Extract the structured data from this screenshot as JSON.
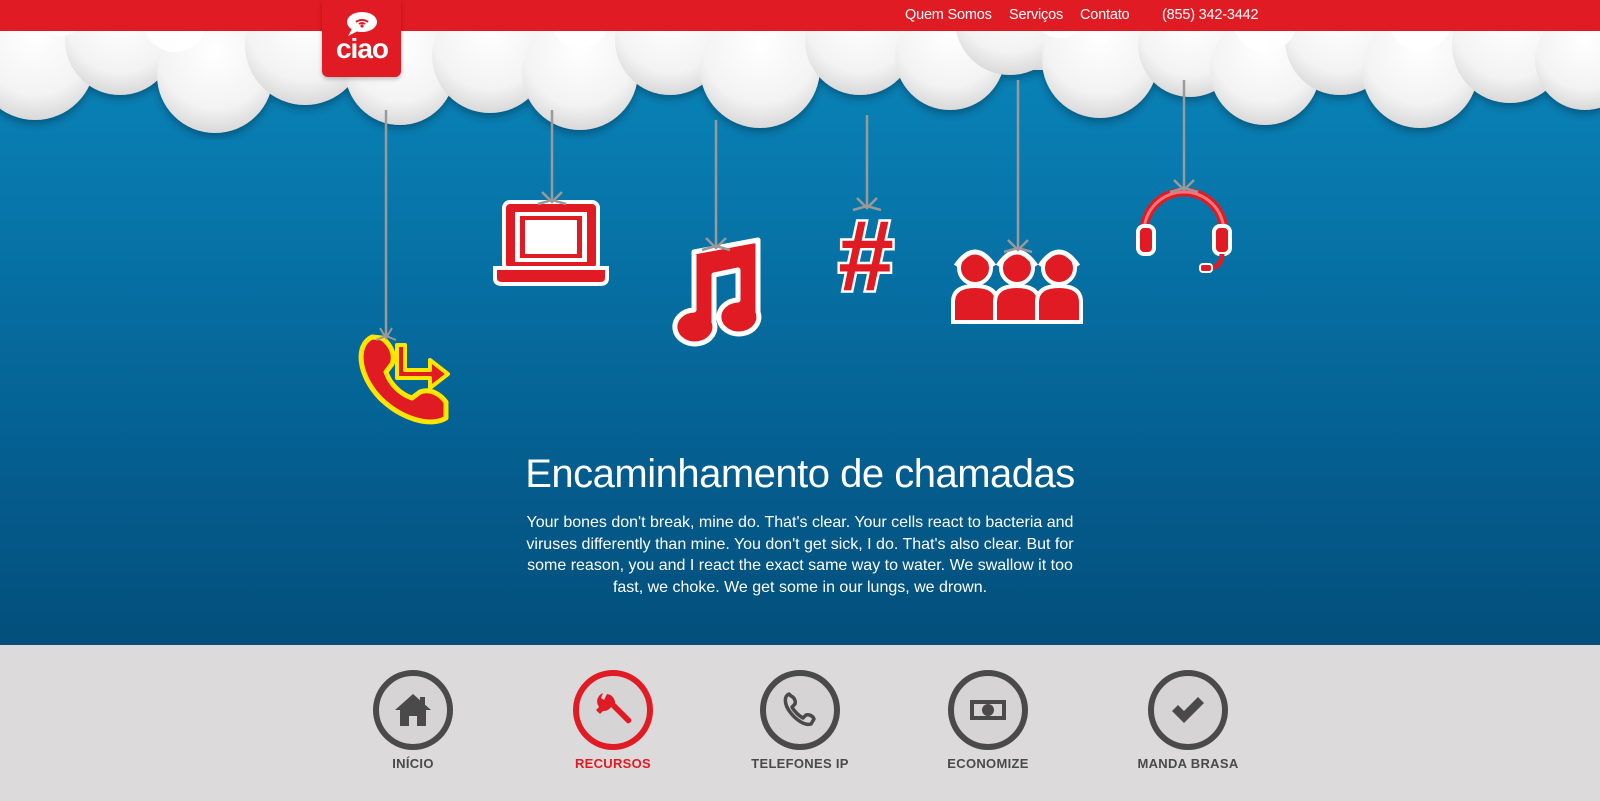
{
  "nav": {
    "items": [
      "Quem Somos",
      "Serviços",
      "Contato"
    ],
    "phone": "(855) 342-3442"
  },
  "logo": {
    "text": "ciao"
  },
  "hero": {
    "title": "Encaminhamento de chamadas",
    "description": "Your bones don't break, mine do. That's clear. Your cells react to bacteria and viruses differently than mine. You don't get sick, I do. That's also clear. But for some reason, you and I react the exact same way to water. We swallow it too fast, we choke. We get some in our lungs, we drown.",
    "hanging_icons": [
      "phone-forward-icon",
      "laptop-icon",
      "music-note-icon",
      "hash-icon",
      "group-icon",
      "headset-icon"
    ]
  },
  "features": [
    {
      "label": "INÍCIO",
      "icon": "home-icon"
    },
    {
      "label": "RECURSOS",
      "icon": "wrench-icon",
      "active": true
    },
    {
      "label": "TELEFONES IP",
      "icon": "phone-icon"
    },
    {
      "label": "ECONOMIZE",
      "icon": "money-icon"
    },
    {
      "label": "MANDA BRASA",
      "icon": "check-icon"
    }
  ],
  "colors": {
    "brand_red": "#e01b23",
    "sky_blue": "#0774a8",
    "dark_gray": "#4a4a4a",
    "highlight_yellow": "#ffe600"
  }
}
